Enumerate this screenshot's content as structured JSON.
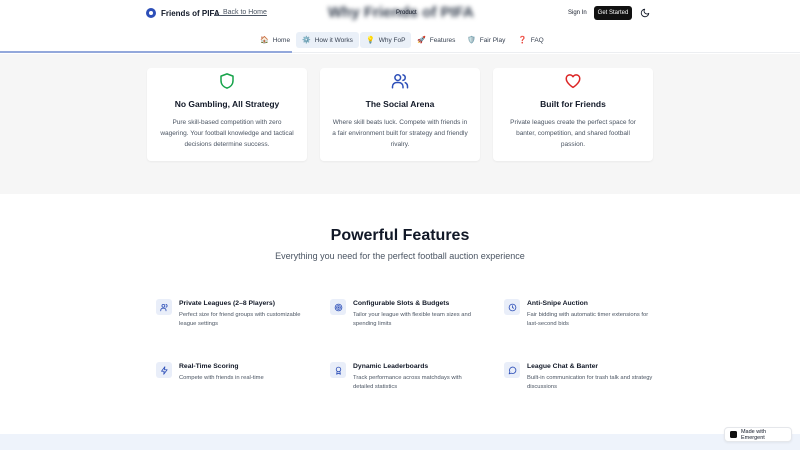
{
  "header": {
    "brand_name": "Friends of PIFA",
    "back_link": "← Back to Home",
    "title": "Why Friends of PIFA",
    "product": "Product",
    "sign_in": "Sign In",
    "get_started": "Get Started",
    "theme_icon": "moon-icon"
  },
  "nav": {
    "tabs": [
      {
        "label": "Home",
        "icon": "🏠",
        "active": false
      },
      {
        "label": "How it Works",
        "icon": "⚙️",
        "active": true
      },
      {
        "label": "Why FoP",
        "icon": "💡",
        "active": true
      },
      {
        "label": "Features",
        "icon": "🚀",
        "active": false
      },
      {
        "label": "Fair Play",
        "icon": "🛡️",
        "active": false
      },
      {
        "label": "FAQ",
        "icon": "❓",
        "active": false
      }
    ]
  },
  "arena_cards": [
    {
      "icon": "shield-icon",
      "title": "No Gambling, All Strategy",
      "desc": "Pure skill-based competition with zero wagering. Your football knowledge and tactical decisions determine success.",
      "color": "#16a34a"
    },
    {
      "icon": "users-icon",
      "title": "The Social Arena",
      "desc": "Where skill beats luck. Compete with friends in a fair environment built for strategy and friendly rivalry.",
      "color": "#2d4fb8"
    },
    {
      "icon": "heart-icon",
      "title": "Built for Friends",
      "desc": "Private leagues create the perfect space for banter, competition, and shared football passion.",
      "color": "#dc2626"
    }
  ],
  "features": {
    "title": "Powerful Features",
    "subtitle": "Everything you need for the perfect football auction experience",
    "items": [
      {
        "icon": "users-icon",
        "title": "Private Leagues (2–8 Players)",
        "desc": "Perfect size for friend groups with customizable league settings"
      },
      {
        "icon": "target-icon",
        "title": "Configurable Slots & Budgets",
        "desc": "Tailor your league with flexible team sizes and spending limits"
      },
      {
        "icon": "clock-icon",
        "title": "Anti-Snipe Auction",
        "desc": "Fair bidding with automatic timer extensions for last-second bids"
      },
      {
        "icon": "lightning-icon",
        "title": "Real-Time Scoring",
        "desc": "Compete with friends in real-time"
      },
      {
        "icon": "award-icon",
        "title": "Dynamic Leaderboards",
        "desc": "Track performance across matchdays with detailed statistics"
      },
      {
        "icon": "chat-icon",
        "title": "League Chat & Banter",
        "desc": "Built-in communication for trash talk and strategy discussions"
      }
    ]
  },
  "badge": {
    "label": "Made with Emergent"
  },
  "colors": {
    "accent": "#2d4fb8",
    "tab_active_bg": "#eaf0f8",
    "section_bg": "#f6f6f6"
  }
}
